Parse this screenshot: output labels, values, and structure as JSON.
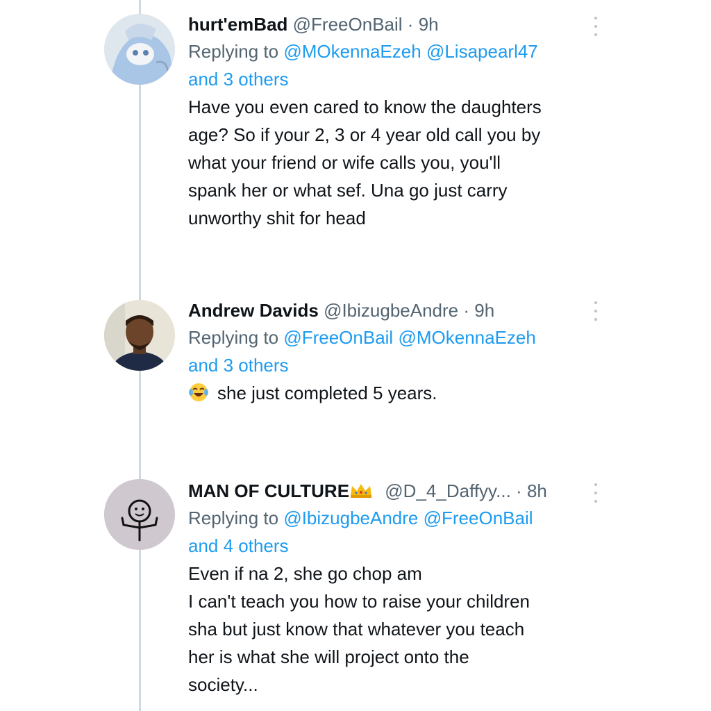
{
  "tweets": [
    {
      "name": "hurt'emBad",
      "handle": "@FreeOnBail",
      "sep": "·",
      "time": "9h",
      "replying_label": "Replying to",
      "mentions": [
        "@MOkennaEzeh",
        "@Lisapearl47"
      ],
      "others": "and 3 others",
      "lines": [
        "Have you even cared to know the daughters",
        "age? So if your 2, 3 or 4 year old call you by",
        "what your friend or wife calls you, you'll",
        "spank her or what sef. Una go just carry",
        "unworthy shit for head"
      ],
      "avatar_icon": "anime-character-avatar"
    },
    {
      "name": "Andrew Davids",
      "handle": "@IbizugbeAndre",
      "sep": "·",
      "time": "9h",
      "replying_label": "Replying to",
      "mentions": [
        "@FreeOnBail",
        "@MOkennaEzeh"
      ],
      "others": "and 3 others",
      "emoji": "😂",
      "lines": [
        "she just completed 5 years."
      ],
      "avatar_icon": "man-photo-avatar"
    },
    {
      "name": "MAN OF CULTURE",
      "name_emoji": "👑",
      "handle": "@D_4_Daffyy...",
      "sep": "·",
      "time": "8h",
      "replying_label": "Replying to",
      "mentions": [
        "@IbizugbeAndre",
        "@FreeOnBail"
      ],
      "others": "and 4 others",
      "lines": [
        "Even if na 2, she go chop am",
        "I can't teach you how to raise your children",
        "sha but just know that whatever you teach",
        "her is what she will project onto the",
        "society..."
      ],
      "avatar_icon": "stick-figure-avatar"
    }
  ],
  "colors": {
    "link": "#1d9bf0",
    "secondary": "#536471",
    "thread_line": "#cfd9de"
  }
}
